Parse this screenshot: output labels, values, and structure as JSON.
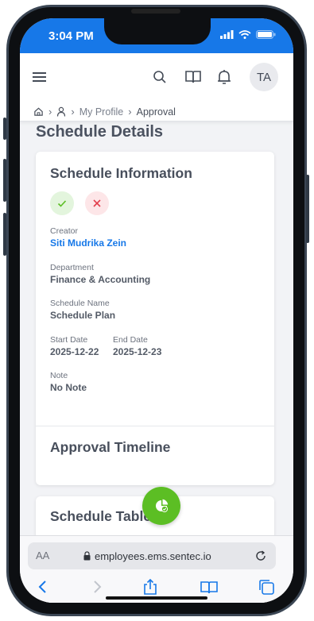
{
  "status_bar": {
    "time": "3:04 PM"
  },
  "header": {
    "menu_icon": "hamburger-icon",
    "search_icon": "search-icon",
    "book_icon": "book-icon",
    "bell_icon": "bell-icon",
    "avatar_initials": "TA"
  },
  "breadcrumb": {
    "home_icon": "home-icon",
    "user_icon": "user-icon",
    "items": [
      "My Profile",
      "Approval"
    ]
  },
  "page": {
    "title": "Schedule Details"
  },
  "info_card": {
    "title": "Schedule Information",
    "creator_label": "Creator",
    "creator_value": "Siti Mudrika Zein",
    "department_label": "Department",
    "department_value": "Finance & Accounting",
    "schedule_name_label": "Schedule Name",
    "schedule_name_value": "Schedule Plan",
    "start_date_label": "Start Date",
    "start_date_value": "2025-12-22",
    "end_date_label": "End Date",
    "end_date_value": "2025-12-23",
    "note_label": "Note",
    "note_value": "No Note",
    "timeline_title": "Approval Timeline"
  },
  "table_card": {
    "title": "Schedule Table"
  },
  "browser": {
    "aa_label": "AA",
    "url": "employees.ems.sentec.io"
  },
  "colors": {
    "accent": "#1778e8",
    "approve": "#5cbe24",
    "reject": "#e23b4a",
    "fab": "#5cbe24"
  }
}
